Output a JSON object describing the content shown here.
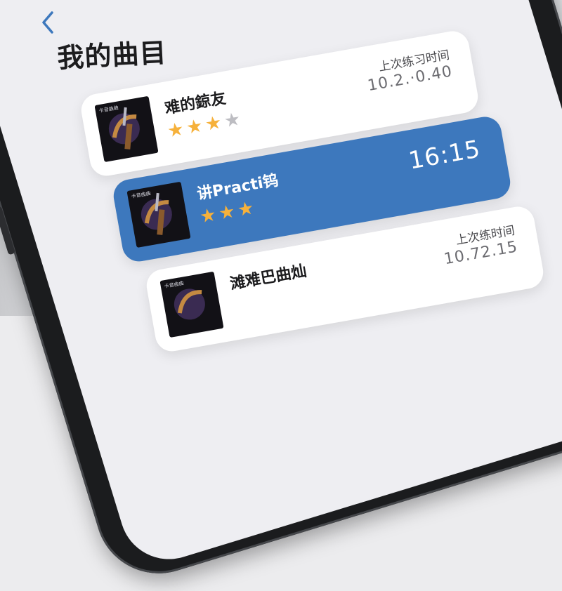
{
  "nav": {
    "back_icon": "chevron-left-icon",
    "accent": "#3d78bd"
  },
  "page_title": "我的曲目",
  "colors": {
    "star_filled": "#f6b13b",
    "star_empty": "#bdbdc2",
    "active_card": "#3d78bd"
  },
  "songs": [
    {
      "thumb_label": "卡音曲曲",
      "title": "难的鍄友",
      "rating_filled": 3,
      "rating_max": 4,
      "meta_label": "上次练习时间",
      "meta_time": "10.2.·0.40"
    },
    {
      "thumb_label": "卡音曲曲",
      "title": "讲Practi钨",
      "rating_filled": 3,
      "rating_max": 3,
      "big_time": "16:15",
      "active": true
    },
    {
      "thumb_label": "卡音曲曲",
      "title": "滩难巴曲灿",
      "meta_label": "上次练时间",
      "meta_time": "10.72.15"
    }
  ]
}
